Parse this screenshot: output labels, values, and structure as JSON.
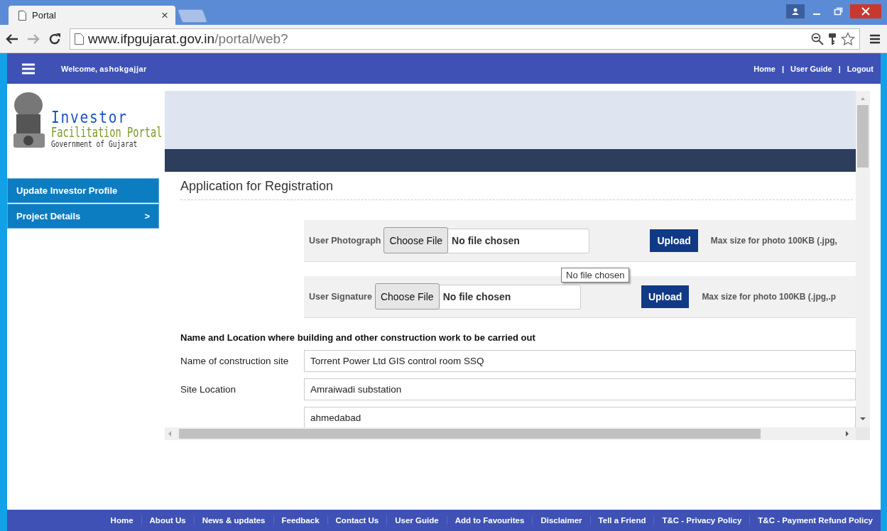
{
  "browser": {
    "tab_title": "Portal",
    "tab_close": "×",
    "url_host": "www.ifpgujarat.gov.in",
    "url_path": "/portal/web?"
  },
  "header": {
    "welcome": "Welcome,",
    "user": "ashokgajjar",
    "links": [
      "Home",
      "User Guide",
      "Logout"
    ],
    "separators": [
      "|",
      "|"
    ]
  },
  "logo": {
    "title": "Investor",
    "subtitle": "Facilitation Portal",
    "caption": "Government of Gujarat"
  },
  "sidebar": {
    "items": [
      {
        "label": "Update Investor Profile"
      },
      {
        "label": "Project Details",
        "chevron": ">"
      }
    ]
  },
  "form": {
    "title": "Application for Registration",
    "uploads": [
      {
        "label": "User Photograph",
        "choose": "Choose File",
        "status": "No file chosen",
        "upload": "Upload",
        "note": "Max size for photo 100KB (.jpg,"
      },
      {
        "label": "User Signature",
        "choose": "Choose File",
        "status": "No file chosen",
        "upload": "Upload",
        "note": "Max size for photo 100KB (.jpg,.p"
      }
    ],
    "tooltip": "No file chosen",
    "section_heading": "Name and Location where building and other construction work to be carried out",
    "fields": [
      {
        "label": "Name of construction site",
        "value": "Torrent Power Ltd GIS control room SSQ"
      },
      {
        "label": "Site Location",
        "value": "Amraiwadi substation"
      },
      {
        "value": "ahmedabad"
      }
    ]
  },
  "footer": {
    "links": [
      "Home",
      "About Us",
      "News & updates",
      "Feedback",
      "Contact Us",
      "User Guide",
      "Add to Favourites",
      "Disclaimer",
      "Tell a Friend",
      "T&C - Privacy Policy",
      "T&C - Payment Refund Policy"
    ]
  }
}
